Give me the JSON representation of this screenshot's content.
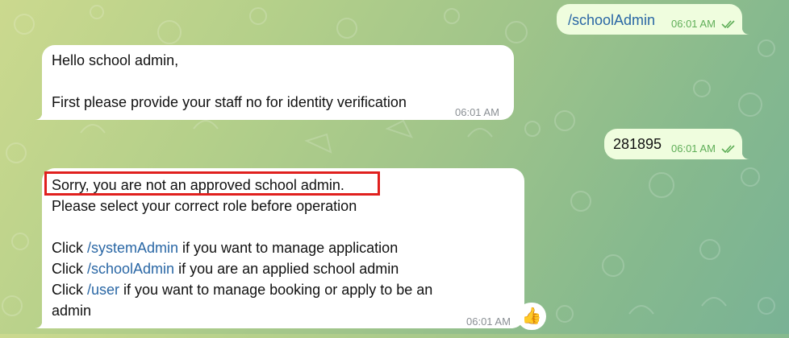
{
  "messages": {
    "out1": {
      "text": "/schoolAdmin",
      "time": "06:01 AM"
    },
    "in1": {
      "line1": "Hello school admin,",
      "line2": "First please provide your staff no for identity verification",
      "time": "06:01 AM"
    },
    "out2": {
      "text": "281895",
      "time": "06:01 AM"
    },
    "in2": {
      "line1": "Sorry, you are not an approved school admin.",
      "line2": "Please select your correct role before operation",
      "click1": {
        "prefix": "Click ",
        "link": "/systemAdmin",
        "suffix": " if you want to manage application"
      },
      "click2": {
        "prefix": "Click ",
        "link": "/schoolAdmin",
        "suffix": " if you are an applied school admin"
      },
      "click3": {
        "prefix": "Click ",
        "link": "/user",
        "suffix": " if you want to manage booking or apply to be an"
      },
      "line_last": "admin",
      "time": "06:01 AM",
      "reaction": "👍"
    }
  },
  "colors": {
    "incoming_bubble": "#ffffff",
    "outgoing_bubble": "#effdde",
    "link": "#2a67a5",
    "highlight_box": "#e0201e",
    "read_check": "#5fae58"
  },
  "icons": {
    "read_status": "double-check-icon",
    "reaction": "thumbs-up-icon"
  }
}
